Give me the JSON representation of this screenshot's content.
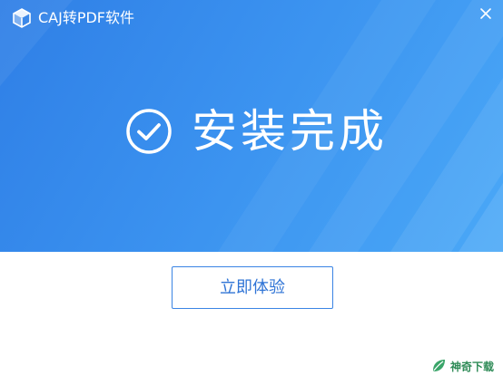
{
  "window": {
    "title": "CAJ转PDF软件"
  },
  "status": {
    "text": "安装完成"
  },
  "actions": {
    "primary_label": "立即体验"
  },
  "watermark": {
    "text": "神奇下载"
  },
  "icons": {
    "logo": "app-logo-icon",
    "close": "close-icon",
    "success": "check-circle-icon",
    "watermark": "leaf-icon"
  },
  "colors": {
    "header_start": "#2f7fe6",
    "header_end": "#4aa8f7",
    "button_text": "#2f74d6",
    "button_border": "#3a84e4",
    "watermark": "#2e8b57"
  }
}
